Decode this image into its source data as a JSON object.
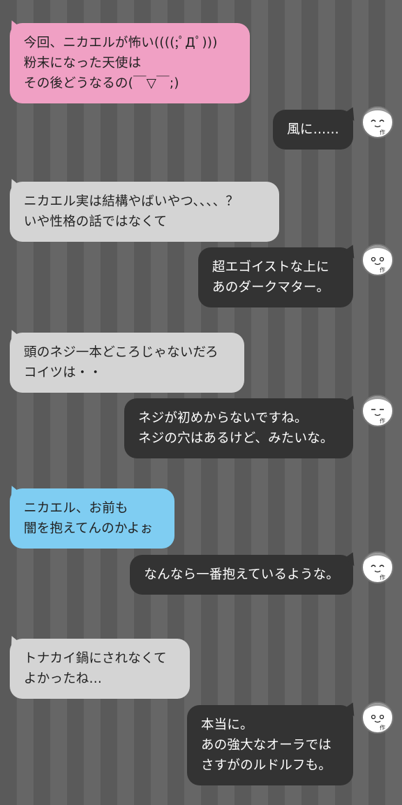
{
  "messages": [
    {
      "side": "left",
      "color": "pink",
      "text": "今回、ニカエルが怖い((((;ﾟДﾟ)))\n粉末になった天使は\nその後どうなるの(￣▽￣;)"
    },
    {
      "side": "right",
      "text": "風に……",
      "avatar": "author-avatar-icon"
    },
    {
      "side": "left",
      "color": "gray",
      "text": "ニカエル実は結構やばいやつ、、、、？\nいや性格の話ではなくて"
    },
    {
      "side": "right",
      "text": "超エゴイストな上に\nあのダークマター。",
      "avatar": "author-avatar-icon"
    },
    {
      "side": "left",
      "color": "gray",
      "text": "頭のネジ一本どころじゃないだろ\nコイツは・・"
    },
    {
      "side": "right",
      "text": "ネジが初めからないですね。\nネジの穴はあるけど、みたいな。",
      "avatar": "author-avatar-icon"
    },
    {
      "side": "left",
      "color": "blue",
      "text": "ニカエル、お前も\n闇を抱えてんのかよぉ"
    },
    {
      "side": "right",
      "text": "なんなら一番抱えているような。",
      "avatar": "author-avatar-icon"
    },
    {
      "side": "left",
      "color": "gray",
      "text": "トナカイ鍋にされなくて\nよかったね…"
    },
    {
      "side": "right",
      "text": "本当に。\nあの強大なオーラでは\nさすがのルドルフも。",
      "avatar": "author-avatar-icon"
    }
  ],
  "avatar_label": "作"
}
